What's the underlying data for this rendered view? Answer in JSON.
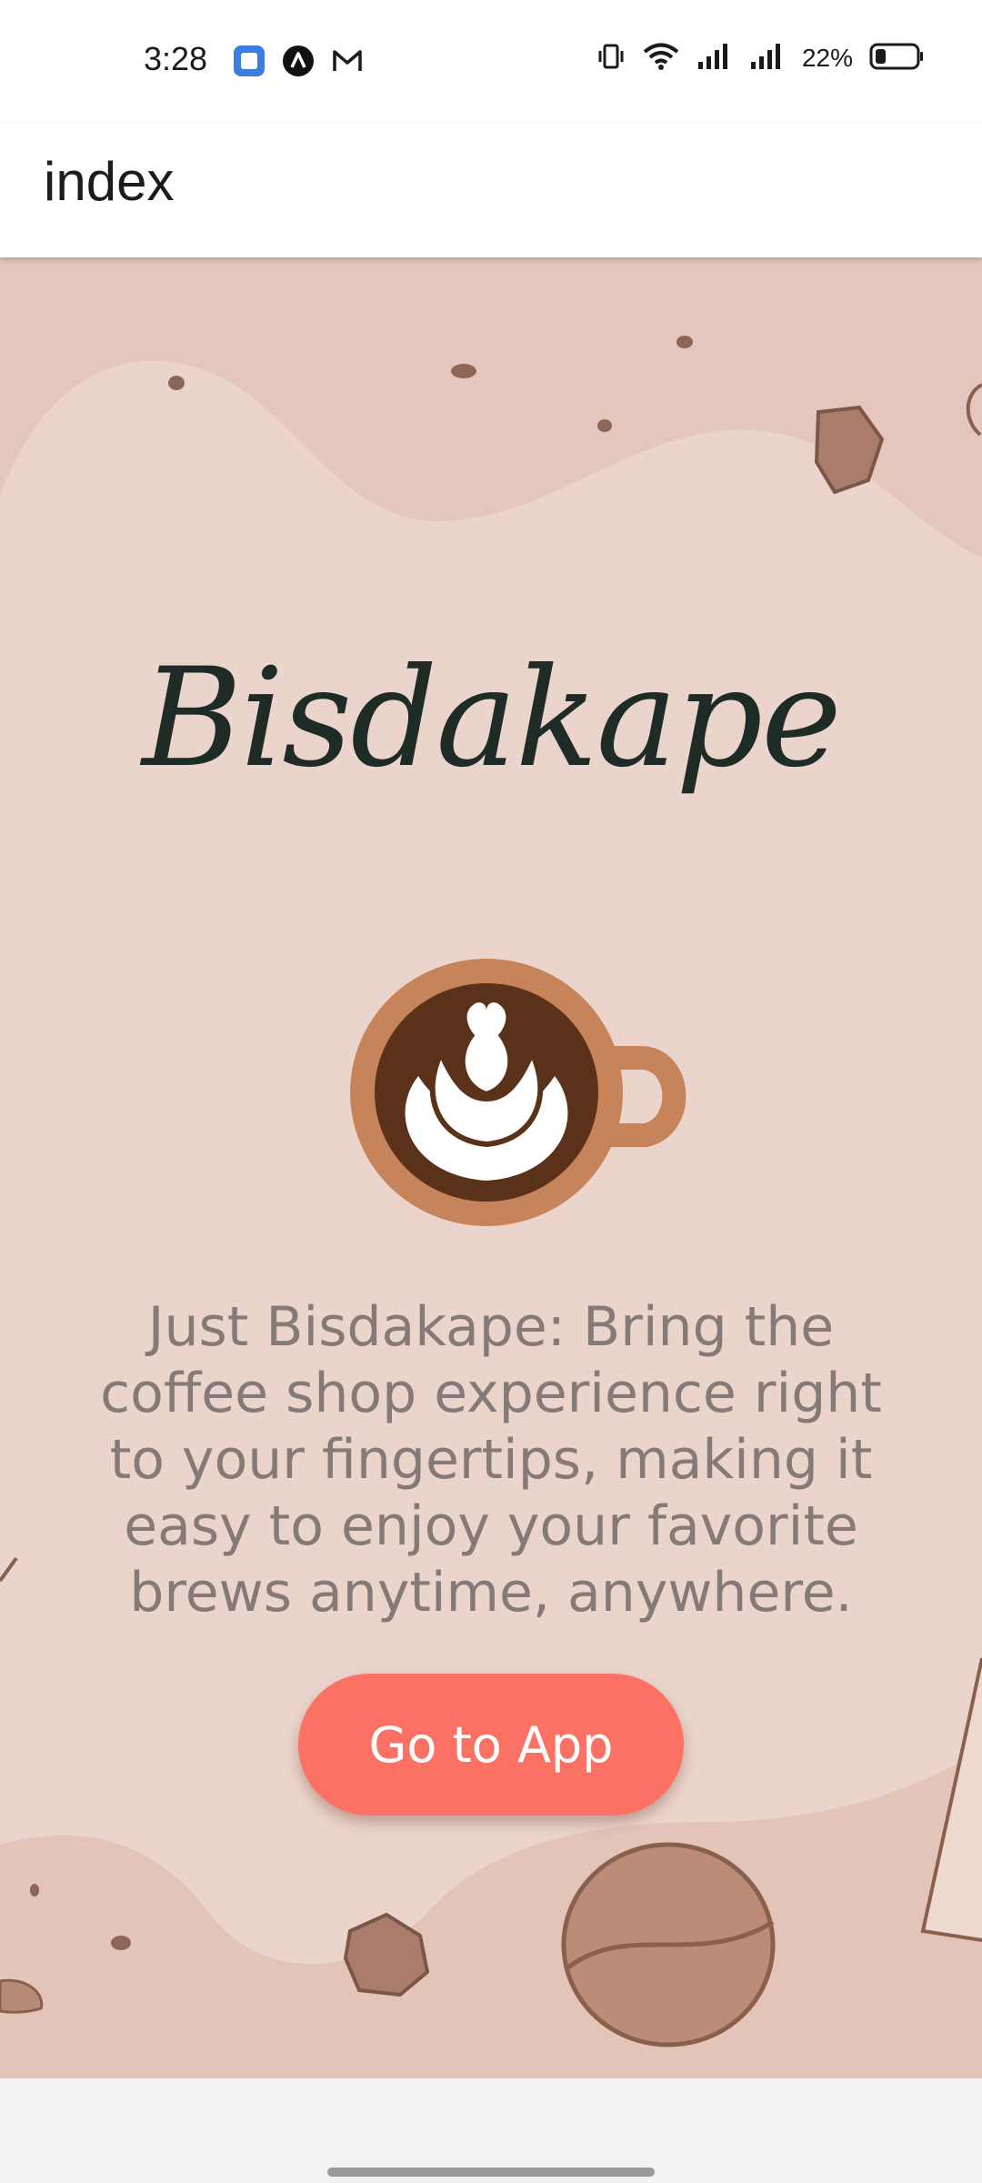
{
  "status_bar": {
    "time": "3:28",
    "notification_icons": [
      "app-notification-icon",
      "arch-notification-icon",
      "gmail-icon"
    ],
    "status_icons": [
      "vibrate-icon",
      "wifi-icon",
      "signal-icon",
      "signal-icon"
    ],
    "battery_percent": "22%"
  },
  "header": {
    "title": "index"
  },
  "hero": {
    "brand": "Bisdakape",
    "tagline": "Just Bisdakape: Bring the coffee shop experience right to your fingertips, making it easy to enjoy your favorite brews anytime, anywhere.",
    "cta_label": "Go to App"
  },
  "colors": {
    "background": "#e8cfc7",
    "cta": "#fb7163",
    "brand_text": "#1f2b27",
    "tagline_text": "#857a78"
  }
}
